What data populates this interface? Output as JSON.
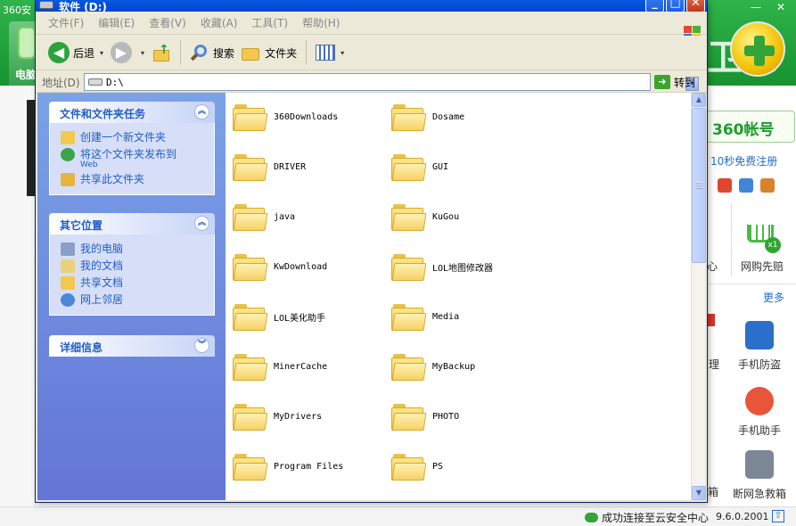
{
  "background_app": {
    "title": "360安",
    "window_buttons": [
      "—",
      "✕"
    ],
    "left_tab_label": "电脑",
    "brand_watermark": "卫士",
    "account_label": "360帐号",
    "register_link": "10秒免费注册",
    "cut_label_1": "心",
    "cart_badge": "x1",
    "cart_label": "网购先赔",
    "more_link": "更多",
    "tools": [
      {
        "label": "手机防盗",
        "color": "#2a6fc9"
      },
      {
        "label": "手机助手",
        "color": "#e8553b"
      },
      {
        "label": "断网急救箱",
        "color": "#7c8796"
      }
    ],
    "cut_label_2": "理",
    "cut_label_3": "箱",
    "status_text": "成功连接至云安全中心",
    "version": "9.6.0.2001",
    "status_icon": "cloud-icon",
    "accent_color": "#17932f"
  },
  "explorer": {
    "title": "软件 (D:)",
    "title_buttons": [
      "_",
      "□",
      "✕"
    ],
    "menu": [
      "文件(F)",
      "编辑(E)",
      "查看(V)",
      "收藏(A)",
      "工具(T)",
      "帮助(H)"
    ],
    "toolbar": {
      "back_label": "后退",
      "forward_label": "",
      "search_label": "搜索",
      "folders_label": "文件夹",
      "drop_glyph": "▾"
    },
    "address": {
      "label": "地址(D)",
      "value": "D:\\",
      "go_label": "转到",
      "go_glyph": "➜",
      "drop_glyph": "▾"
    },
    "task_panels": [
      {
        "title": "文件和文件夹任务",
        "toggle": "︽",
        "tasks": [
          {
            "label": "创建一个新文件夹",
            "sub": "",
            "icon": "new-folder-icon",
            "color": "#f2c94c"
          },
          {
            "label": "将这个文件夹发布到",
            "sub": "Web",
            "icon": "publish-web-icon",
            "color": "#3ba34a"
          },
          {
            "label": "共享此文件夹",
            "sub": "",
            "icon": "share-folder-icon",
            "color": "#e7b43f"
          }
        ]
      },
      {
        "title": "其它位置",
        "toggle": "︽",
        "tasks": [
          {
            "label": "我的电脑",
            "sub": "",
            "icon": "my-computer-icon",
            "color": "#8aa0c8"
          },
          {
            "label": "我的文档",
            "sub": "",
            "icon": "my-documents-icon",
            "color": "#e9d27a"
          },
          {
            "label": "共享文档",
            "sub": "",
            "icon": "shared-documents-icon",
            "color": "#f2c94c"
          },
          {
            "label": "网上邻居",
            "sub": "",
            "icon": "network-places-icon",
            "color": "#4c86d6"
          }
        ]
      },
      {
        "title": "详细信息",
        "toggle": "︾",
        "tasks": []
      }
    ],
    "files": [
      "360Downloads",
      "Dosame",
      "DRIVER",
      "GUI",
      "java",
      "KuGou",
      "KwDownload",
      "LOL地图修改器",
      "LOL美化助手",
      "Media",
      "MinerCache",
      "MyBackup",
      "MyDrivers",
      "PHOTO",
      "Program Files",
      "PS"
    ],
    "scroll": {
      "up": "▲",
      "down": "▼"
    }
  }
}
